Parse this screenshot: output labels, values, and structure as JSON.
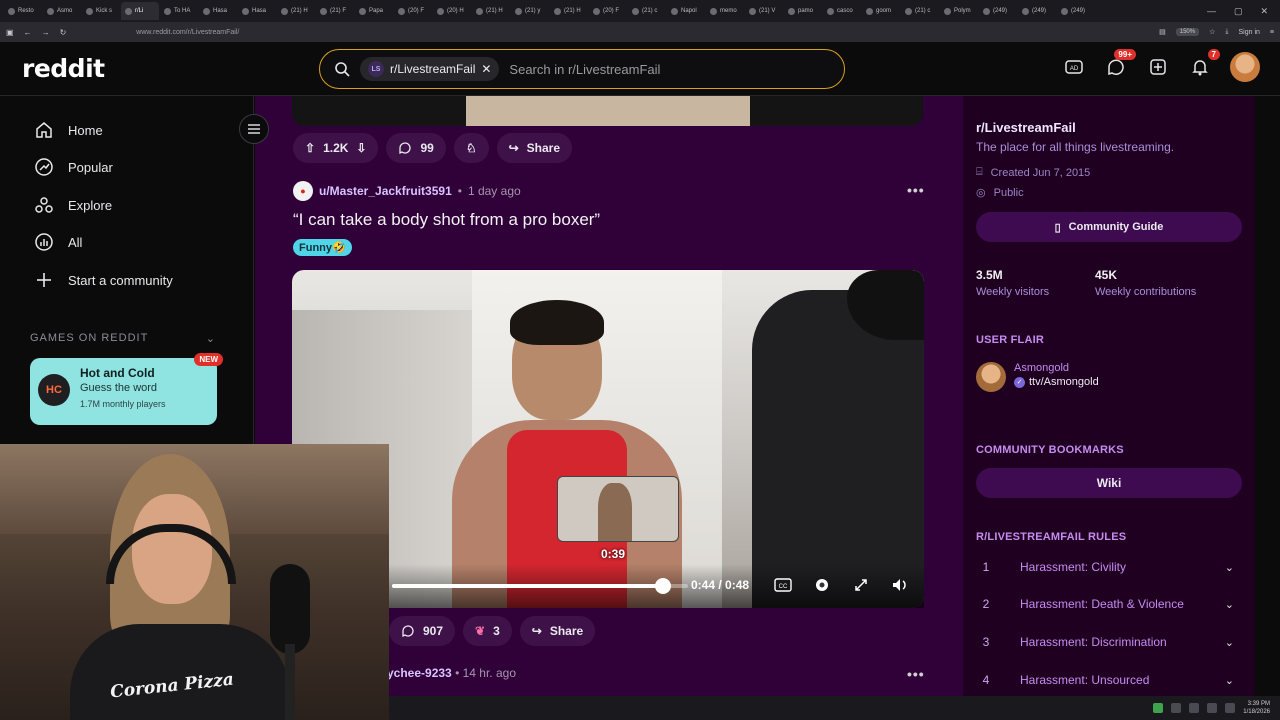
{
  "browser": {
    "tabs": [
      "Resto",
      "Asmo",
      "Kick s",
      "r/Li",
      "To HA",
      "Hasa",
      "Hasa",
      "(21) H",
      "(21) F",
      "Papa",
      "(20) F",
      "(20) H",
      "(21) H",
      "(21) y",
      "(21) H",
      "(20) F",
      "(21) c",
      "Napol",
      "memo",
      "(21) V",
      "pamo",
      "casco",
      "goom",
      "(21) c",
      "Polym",
      "(249)",
      "(249)",
      "(249)"
    ],
    "url": "www.reddit.com/r/LivestreamFail/",
    "zoom": "150%",
    "signin": "Sign in"
  },
  "header": {
    "logo": "reddit",
    "search_chip": "r/LivestreamFail",
    "search_chip_icon": "LS",
    "search_placeholder": "Search in r/LivestreamFail",
    "chat_badge": "99+",
    "notif_badge": "7"
  },
  "leftnav": {
    "items": [
      {
        "label": "Home",
        "icon": "home-icon"
      },
      {
        "label": "Popular",
        "icon": "popular-icon"
      },
      {
        "label": "Explore",
        "icon": "explore-icon"
      },
      {
        "label": "All",
        "icon": "all-icon"
      },
      {
        "label": "Start a community",
        "icon": "plus-icon"
      }
    ],
    "games_header": "GAMES ON REDDIT",
    "game": {
      "title": "Hot and Cold",
      "subtitle": "Guess the word",
      "players": "1.7M monthly players",
      "badge": "NEW",
      "icon_text": "HC"
    }
  },
  "feed": {
    "prev_post": {
      "votes": "1.2K",
      "comments": "99",
      "share": "Share"
    },
    "post": {
      "author": "u/Master_Jackfruit3591",
      "time": "1 day ago",
      "title": "“I can take a body shot from a pro boxer”",
      "flair": "Funny🤣",
      "video": {
        "preview_time": "0:39",
        "timecode": "0:44 / 0:48",
        "progress": 0.9167
      },
      "comments": "907",
      "awards": "3",
      "share": "Share"
    },
    "next_post": {
      "author_partial": "ychee-9233",
      "time": "14 hr. ago"
    }
  },
  "sidebar": {
    "name": "r/LivestreamFail",
    "description": "The place for all things livestreaming.",
    "created": "Created Jun 7, 2015",
    "visibility": "Public",
    "guide_button": "Community Guide",
    "stats": [
      {
        "value": "3.5M",
        "label": "Weekly visitors"
      },
      {
        "value": "45K",
        "label": "Weekly contributions"
      }
    ],
    "user_flair_header": "USER FLAIR",
    "user_flair": {
      "name": "Asmongold",
      "tag": "ttv/Asmongold"
    },
    "bookmarks_header": "COMMUNITY BOOKMARKS",
    "wiki": "Wiki",
    "rules_header": "R/LIVESTREAMFAIL RULES",
    "rules": [
      {
        "num": "1",
        "label": "Harassment: Civility"
      },
      {
        "num": "2",
        "label": "Harassment: Death & Violence"
      },
      {
        "num": "3",
        "label": "Harassment: Discrimination"
      },
      {
        "num": "4",
        "label": "Harassment: Unsourced"
      }
    ]
  },
  "webcam": {
    "shirt_text": "Corona Pizza"
  },
  "taskbar": {
    "time": "3:39 PM",
    "date": "1/18/2026"
  },
  "colors": {
    "accent": "#d8a21b",
    "feed_bg": "#300038",
    "sidebar_bg": "#1f0020",
    "link": "#c58cf0"
  }
}
